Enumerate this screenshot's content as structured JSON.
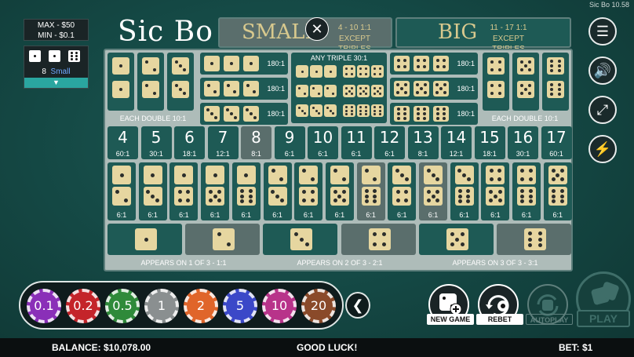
{
  "window_title": "Sic Bo 10.58",
  "limits": {
    "max": "MAX - $50",
    "min": "MIN - $0.1"
  },
  "last_roll": {
    "dice": [
      1,
      1,
      6
    ],
    "total": "8",
    "result": "Small"
  },
  "logo": "Sic Bo",
  "small": {
    "label": "SMALL",
    "odds": "4 - 10 1:1",
    "note": "EXCEPT TRIPLES"
  },
  "big": {
    "label": "BIG",
    "odds": "11 - 17 1:1",
    "note": "EXCEPT TRIPLES"
  },
  "any_triple": "ANY TRIPLE 30:1",
  "each_double": "EACH DOUBLE  10:1",
  "specific_triple_odds": "180:1",
  "totals": [
    {
      "n": "4",
      "odds": "60:1"
    },
    {
      "n": "5",
      "odds": "30:1"
    },
    {
      "n": "6",
      "odds": "18:1"
    },
    {
      "n": "7",
      "odds": "12:1"
    },
    {
      "n": "8",
      "odds": "8:1"
    },
    {
      "n": "9",
      "odds": "6:1"
    },
    {
      "n": "10",
      "odds": "6:1"
    },
    {
      "n": "11",
      "odds": "6:1"
    },
    {
      "n": "12",
      "odds": "6:1"
    },
    {
      "n": "13",
      "odds": "8:1"
    },
    {
      "n": "14",
      "odds": "12:1"
    },
    {
      "n": "15",
      "odds": "18:1"
    },
    {
      "n": "16",
      "odds": "30:1"
    },
    {
      "n": "17",
      "odds": "60:1"
    }
  ],
  "combo_odds": "6:1",
  "appears": {
    "one": "APPEARS ON 1 OF 3 - 1:1",
    "two": "APPEARS ON 2 OF 3 - 2:1",
    "three": "APPEARS ON 3 OF 3 - 3:1"
  },
  "chips": [
    {
      "value": "0.1",
      "color": "#8a2fb8"
    },
    {
      "value": "0.2",
      "color": "#c4242a"
    },
    {
      "value": "0.5",
      "color": "#2f8a3a"
    },
    {
      "value": "1",
      "color": "#8a8f90"
    },
    {
      "value": "2",
      "color": "#e0652a"
    },
    {
      "value": "5",
      "color": "#3b48c8"
    },
    {
      "value": "10",
      "color": "#b8338a"
    },
    {
      "value": "20",
      "color": "#8a4a2a"
    }
  ],
  "buttons": {
    "new_game": "NEW GAME",
    "rebet": "REBET",
    "autoplay": "AUTOPLAY",
    "play": "PLAY"
  },
  "status": {
    "balance": "BALANCE: $10,078.00",
    "message": "GOOD LUCK!",
    "bet": "BET: $1"
  },
  "highlighted_total": "8",
  "highlighted_combos": [
    "2-6",
    "3-5"
  ],
  "colors": {
    "table": "#1e5a55",
    "die": "#e6d6a0",
    "highlight": "#5a6e6c",
    "accent": "#2aa6a0"
  }
}
